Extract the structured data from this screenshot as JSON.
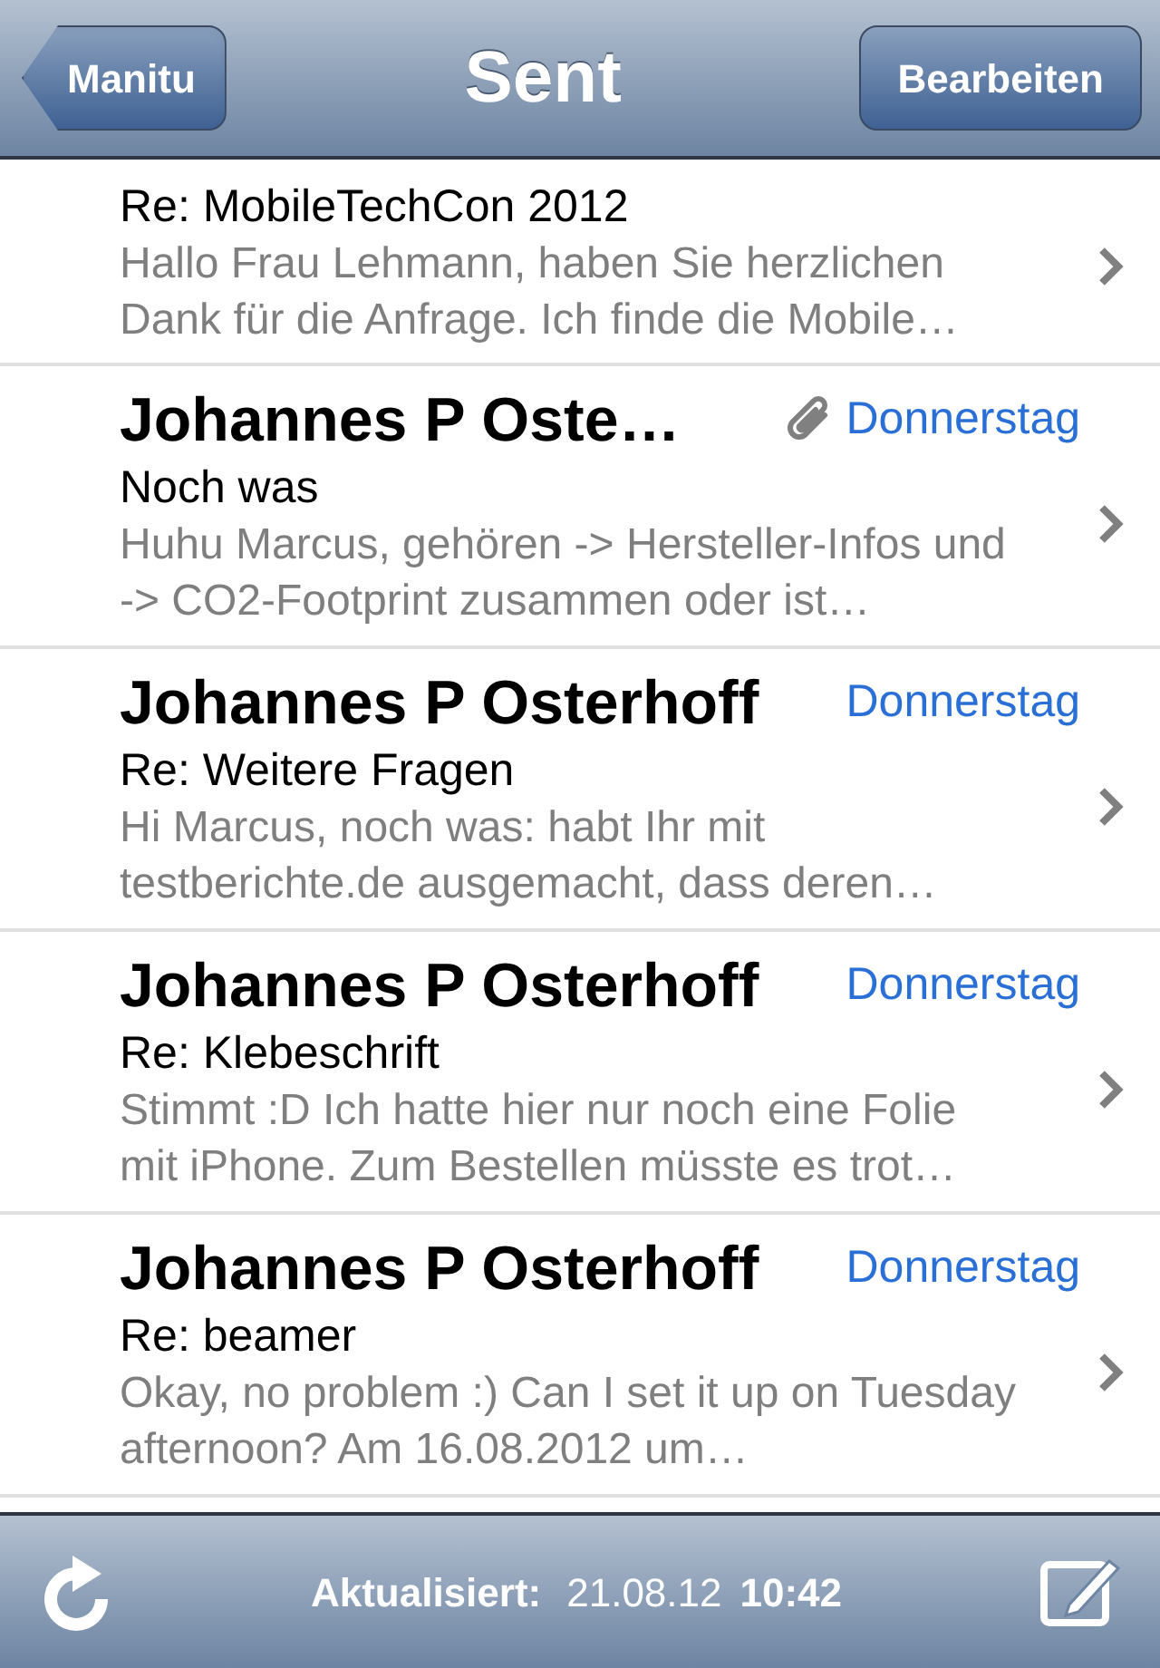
{
  "nav_bar": {
    "back_button": "Manitu",
    "title": "Sent",
    "edit_button": "Bearbeiten"
  },
  "messages": [
    {
      "subject": "Re: MobileTechCon 2012",
      "preview": "Hallo Frau Lehmann, haben Sie herzlichen Dank für die Anfrage. Ich finde die Mobile…",
      "attachment": false
    },
    {
      "sender": "Johannes P Oste…",
      "date": "Donnerstag",
      "subject": "Noch was",
      "preview": "Huhu Marcus, gehören -> Hersteller-Infos und -> CO2-Footprint zusammen oder ist…",
      "attachment": true
    },
    {
      "sender": "Johannes P Osterhoff",
      "date": "Donnerstag",
      "subject": "Re: Weitere Fragen",
      "preview": "Hi Marcus, noch was: habt Ihr mit testberichte.de ausgemacht, dass deren…",
      "attachment": false
    },
    {
      "sender": "Johannes P Osterhoff",
      "date": "Donnerstag",
      "subject": "Re: Klebeschrift",
      "preview": "Stimmt :D Ich hatte hier nur noch eine Folie mit iPhone. Zum Bestellen müsste es trot…",
      "attachment": false
    },
    {
      "sender": "Johannes P Osterhoff",
      "date": "Donnerstag",
      "subject": "Re: beamer",
      "preview": "Okay, no problem :) Can I set it up on Tuesday afternoon? Am 16.08.2012 um…",
      "attachment": false
    }
  ],
  "toolbar": {
    "updated_label": "Aktualisiert:",
    "updated_date": "21.08.12",
    "updated_time": "10:42"
  }
}
